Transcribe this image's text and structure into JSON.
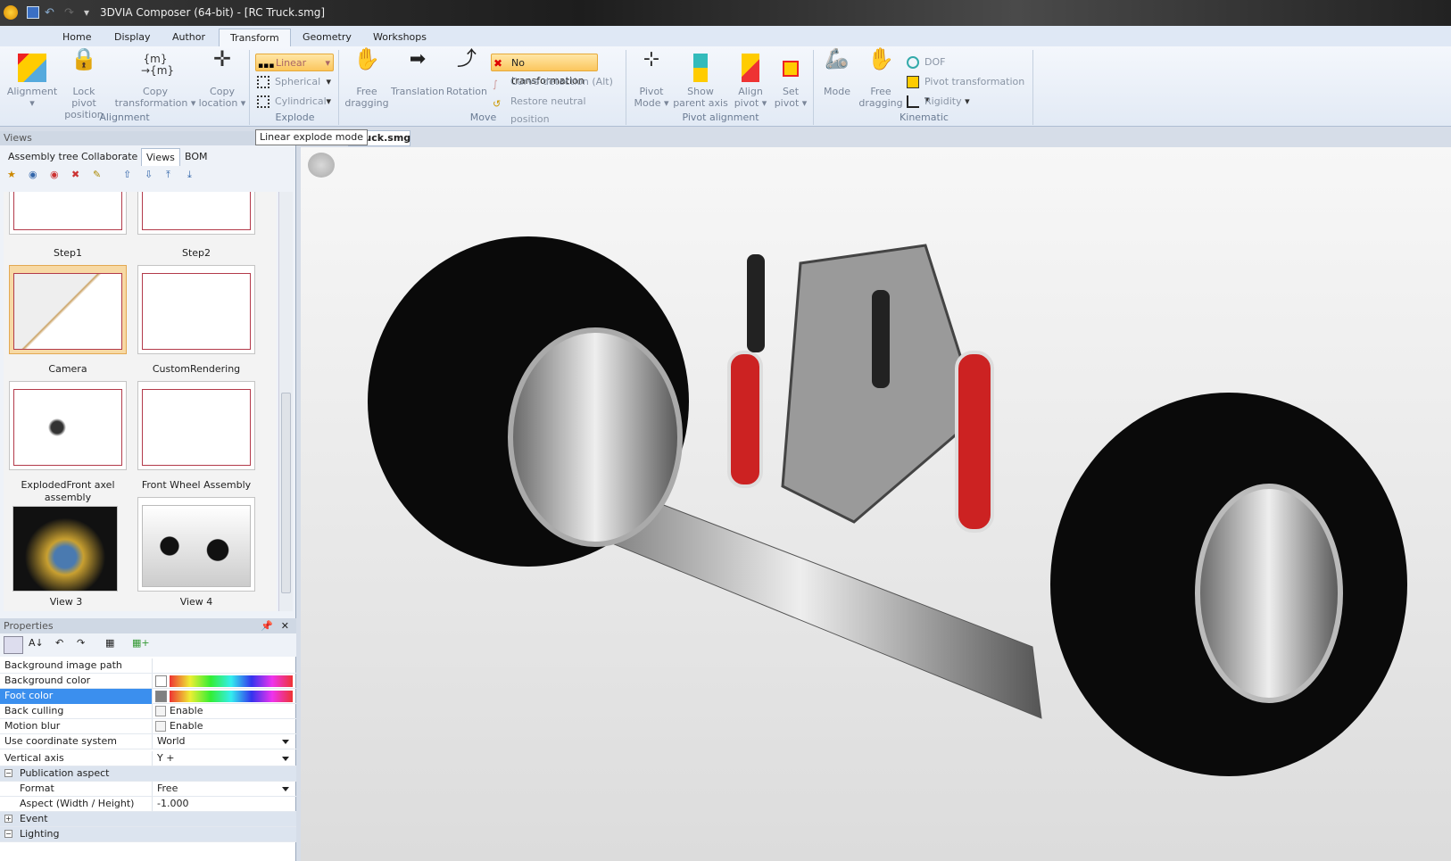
{
  "window": {
    "title": "3DVIA Composer (64-bit) - [RC Truck.smg]"
  },
  "tabs": [
    "Home",
    "Display",
    "Author",
    "Transform",
    "Geometry",
    "Workshops"
  ],
  "active_tab": "Transform",
  "ribbon": {
    "alignment": {
      "label": "Alignment",
      "buttons": [
        "Alignment",
        "Lock pivot position",
        "Copy transformation",
        "Copy location"
      ]
    },
    "explode": {
      "label": "Explode",
      "linear": "Linear",
      "spherical": "Spherical",
      "cylindrical": "Cylindrical"
    },
    "move": {
      "label": "Move",
      "free_dragging": "Free dragging",
      "translation": "Translation",
      "rotation": "Rotation",
      "no_transformation": "No transformation",
      "curve_detection": "Curve detection (Alt)",
      "restore": "Restore neutral position"
    },
    "pivot": {
      "label": "Pivot alignment",
      "buttons": [
        "Pivot Mode",
        "Show parent axis",
        "Align pivot",
        "Set pivot"
      ]
    },
    "kinematic": {
      "label": "Kinematic",
      "mode": "Mode",
      "free_dragging": "Free dragging",
      "dof": "DOF",
      "pivot_transformation": "Pivot transformation",
      "rigidity": "Rigidity"
    }
  },
  "tooltip": "Linear explode mode",
  "views_header": "Views",
  "document_tab": "ruck.smg",
  "panel_tabs": [
    "Assembly tree",
    "Collaborate",
    "Views",
    "BOM"
  ],
  "active_panel_tab": "Views",
  "views": [
    {
      "label": "Step1"
    },
    {
      "label": "Step2"
    },
    {
      "label": "Camera",
      "selected": true
    },
    {
      "label": "CustomRendering"
    },
    {
      "label": "ExplodedFront axel assembly"
    },
    {
      "label": "Front Wheel Assembly"
    },
    {
      "label": "View 3"
    },
    {
      "label": "View 4"
    }
  ],
  "properties": {
    "title": "Properties",
    "rows": [
      {
        "key": "Background image path",
        "value": ""
      },
      {
        "key": "Background color",
        "type": "color",
        "swatch": "#ffffff"
      },
      {
        "key": "Foot color",
        "type": "color",
        "swatch": "#808080",
        "selected": true
      },
      {
        "key": "Back culling",
        "type": "check",
        "value": "Enable"
      },
      {
        "key": "Motion blur",
        "type": "check",
        "value": "Enable"
      },
      {
        "key": "Use coordinate system",
        "type": "select",
        "value": "World"
      },
      {
        "key": "Vertical axis",
        "type": "select",
        "value": "Y +"
      },
      {
        "key": "Publication aspect",
        "type": "section",
        "expanded": true
      },
      {
        "key": "Format",
        "type": "select",
        "value": "Free",
        "indent": true
      },
      {
        "key": "Aspect (Width / Height)",
        "value": "-1.000",
        "indent": true
      },
      {
        "key": "Event",
        "type": "section",
        "expanded": false
      },
      {
        "key": "Lighting",
        "type": "section",
        "expanded": true
      }
    ]
  },
  "colors": {
    "accent": "#3b8fee",
    "highlight": "#fbc65d"
  }
}
